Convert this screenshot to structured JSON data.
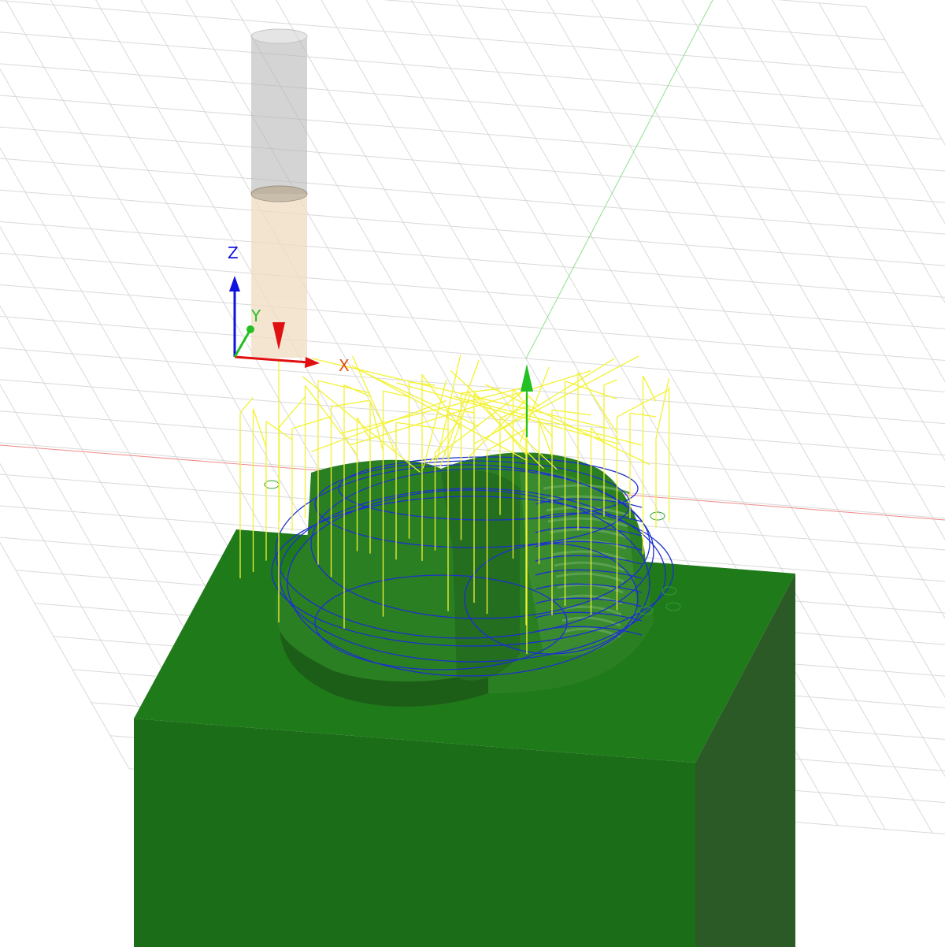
{
  "viewport": {
    "background": "#ffffff",
    "grid_color": "#d9d9d9",
    "x_axis_line_color": "#f08a8a",
    "y_axis_line_color": "#8fe08f"
  },
  "triad": {
    "x_label": "X",
    "y_label": "Y",
    "z_label": "Z",
    "x_color": "#e01010",
    "y_color": "#22c022",
    "z_color": "#1010e0",
    "x_label_color": "#e05010"
  },
  "tool": {
    "holder_color": "#c8c8c8",
    "cutter_color": "#f0d8b8"
  },
  "stock": {
    "top_color": "#1f7a1a",
    "front_color": "#1a6a16",
    "side_color": "#2e5e2a"
  },
  "toolpath": {
    "rapid_color": "#f2f234",
    "feed_color": "#1c2fd0",
    "lead_color": "#2fa02f"
  }
}
